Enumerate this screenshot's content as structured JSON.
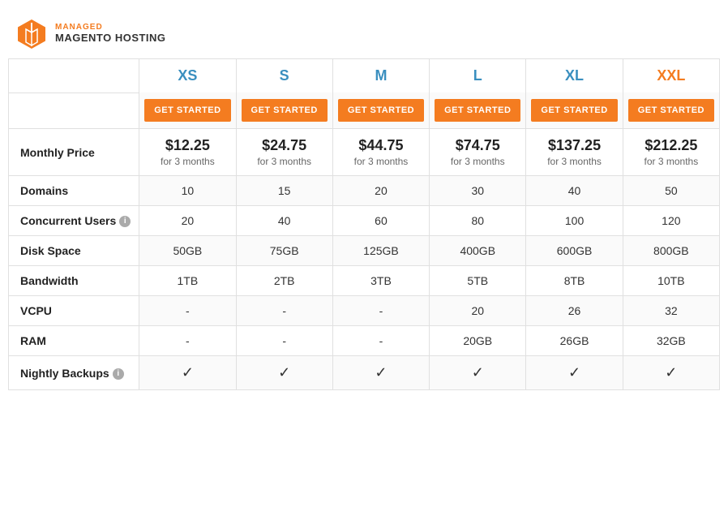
{
  "logo": {
    "top_label": "MANAGED",
    "bottom_label": "MAGENTO HOSTING"
  },
  "plans": [
    {
      "id": "xs",
      "name": "XS",
      "color": "#3a8fbf",
      "button": "GET STARTED"
    },
    {
      "id": "s",
      "name": "S",
      "color": "#3a8fbf",
      "button": "GET STARTED"
    },
    {
      "id": "m",
      "name": "M",
      "color": "#3a8fbf",
      "button": "GET STARTED"
    },
    {
      "id": "l",
      "name": "L",
      "color": "#3a8fbf",
      "button": "GET STARTED"
    },
    {
      "id": "xl",
      "name": "XL",
      "color": "#3a8fbf",
      "button": "GET STARTED"
    },
    {
      "id": "xxl",
      "name": "XXL",
      "color": "#f47c20",
      "button": "GET STARTED"
    }
  ],
  "rows": [
    {
      "label": "Monthly Price",
      "has_info": false,
      "values": [
        {
          "main": "$12.25",
          "sub": "for 3 months"
        },
        {
          "main": "$24.75",
          "sub": "for 3 months"
        },
        {
          "main": "$44.75",
          "sub": "for 3 months"
        },
        {
          "main": "$74.75",
          "sub": "for 3 months"
        },
        {
          "main": "$137.25",
          "sub": "for 3 months"
        },
        {
          "main": "$212.25",
          "sub": "for 3 months"
        }
      ],
      "type": "price"
    },
    {
      "label": "Domains",
      "has_info": false,
      "values": [
        "10",
        "15",
        "20",
        "30",
        "40",
        "50"
      ],
      "type": "text"
    },
    {
      "label": "Concurrent Users",
      "has_info": true,
      "values": [
        "20",
        "40",
        "60",
        "80",
        "100",
        "120"
      ],
      "type": "text"
    },
    {
      "label": "Disk Space",
      "has_info": false,
      "values": [
        "50GB",
        "75GB",
        "125GB",
        "400GB",
        "600GB",
        "800GB"
      ],
      "type": "text"
    },
    {
      "label": "Bandwidth",
      "has_info": false,
      "values": [
        "1TB",
        "2TB",
        "3TB",
        "5TB",
        "8TB",
        "10TB"
      ],
      "type": "text"
    },
    {
      "label": "VCPU",
      "has_info": false,
      "values": [
        "-",
        "-",
        "-",
        "20",
        "26",
        "32"
      ],
      "type": "text"
    },
    {
      "label": "RAM",
      "has_info": false,
      "values": [
        "-",
        "-",
        "-",
        "20GB",
        "26GB",
        "32GB"
      ],
      "type": "text"
    },
    {
      "label": "Nightly Backups",
      "has_info": true,
      "values": [
        "✓",
        "✓",
        "✓",
        "✓",
        "✓",
        "✓"
      ],
      "type": "check"
    }
  ]
}
